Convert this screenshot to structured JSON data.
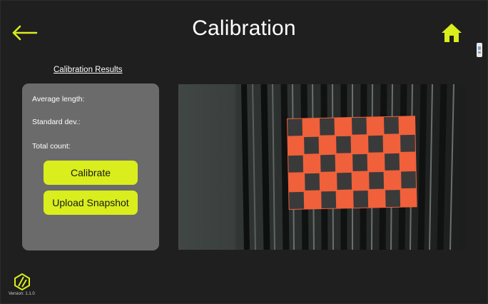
{
  "header": {
    "title": "Calibration",
    "back_icon": "arrow-left-icon",
    "home_icon": "home-icon",
    "accent_color": "#d9ee1c"
  },
  "results": {
    "heading": "Calibration Results",
    "average_length_label": "Average length:",
    "standard_dev_label": "Standard dev.:",
    "total_count_label": "Total count:"
  },
  "actions": {
    "calibrate_label": "Calibrate",
    "upload_snapshot_label": "Upload Snapshot"
  },
  "camera": {
    "target_color": "#f0603a",
    "square_color": "#3a3a3a"
  },
  "footer": {
    "logo_icon": "app-logo-icon",
    "version": "Version: 1.1.0"
  }
}
